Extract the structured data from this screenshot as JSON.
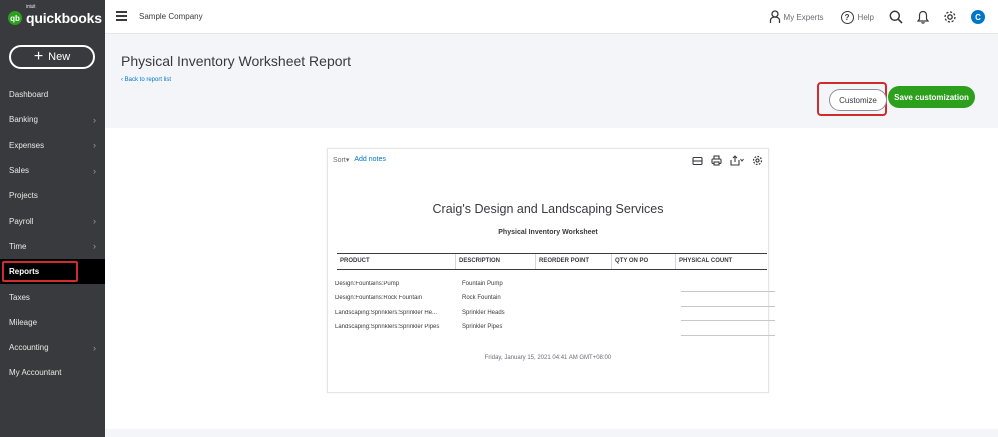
{
  "app": {
    "logo_small": "intuit",
    "logo_text": "quickbooks",
    "logo_icon": "qb-icon"
  },
  "sidebar": {
    "new_label": "New",
    "items": [
      {
        "label": "Dashboard",
        "chevron": false
      },
      {
        "label": "Banking",
        "chevron": true
      },
      {
        "label": "Expenses",
        "chevron": true
      },
      {
        "label": "Sales",
        "chevron": true
      },
      {
        "label": "Projects",
        "chevron": false
      },
      {
        "label": "Payroll",
        "chevron": true
      },
      {
        "label": "Time",
        "chevron": true
      },
      {
        "label": "Reports",
        "chevron": false,
        "active": true
      },
      {
        "label": "Taxes",
        "chevron": false
      },
      {
        "label": "Mileage",
        "chevron": false
      },
      {
        "label": "Accounting",
        "chevron": true
      },
      {
        "label": "My Accountant",
        "chevron": false
      }
    ]
  },
  "topbar": {
    "company": "Sample Company",
    "experts_label": "My Experts",
    "help_label": "Help",
    "avatar_initial": "C"
  },
  "header": {
    "title": "Physical Inventory Worksheet Report",
    "back_link": "Back to report list",
    "customize_label": "Customize",
    "save_label": "Save customization"
  },
  "report": {
    "sort_label": "Sort",
    "add_notes_label": "Add notes",
    "company_name": "Craig's Design and Landscaping Services",
    "title": "Physical Inventory Worksheet",
    "columns": [
      "PRODUCT",
      "DESCRIPTION",
      "REORDER POINT",
      "QTY ON PO",
      "PHYSICAL COUNT"
    ],
    "rows": [
      {
        "product": "Design:Fountains:Pump",
        "description": "Fountain Pump"
      },
      {
        "product": "Design:Fountains:Rock Fountain",
        "description": "Rock Fountain"
      },
      {
        "product": "Landscaping:Sprinklers:Sprinkler He...",
        "description": "Sprinkler Heads"
      },
      {
        "product": "Landscaping:Sprinklers:Sprinkler Pipes",
        "description": "Sprinkler Pipes"
      }
    ],
    "footer": "Friday, January 15, 2021   04:41 AM GMT+08:00"
  },
  "colors": {
    "sidebar_bg": "#393a3d",
    "brand_green": "#2ca01c",
    "link_blue": "#0077c5",
    "highlight_red": "#d12c2c"
  }
}
